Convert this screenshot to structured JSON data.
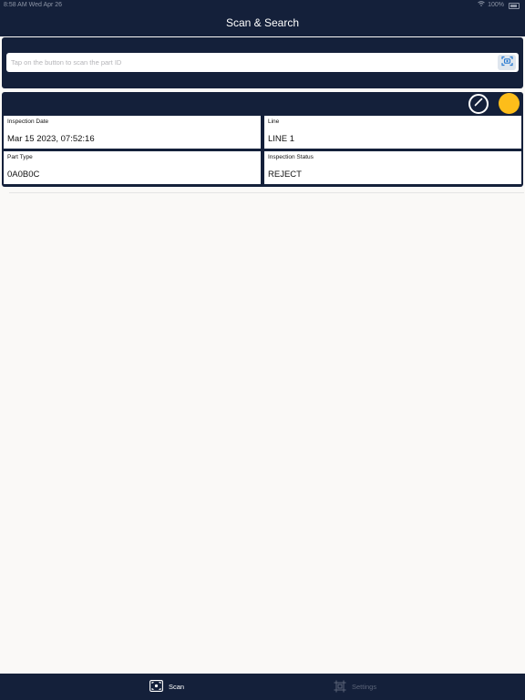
{
  "status_bar": {
    "time_date": "8:58 AM   Wed Apr 26",
    "battery": "100%"
  },
  "nav": {
    "title": "Scan & Search"
  },
  "search": {
    "placeholder": "Tap on the button to scan the part ID",
    "value": ""
  },
  "record": {
    "status_color": "#fdbd1a",
    "fields": [
      {
        "label": "Inspection Date",
        "value": "Mar 15 2023, 07:52:16"
      },
      {
        "label": "Line",
        "value": "LINE 1"
      },
      {
        "label": "Part Type",
        "value": "0A0B0C"
      },
      {
        "label": "Inspection Status",
        "value": "REJECT"
      }
    ]
  },
  "tabs": [
    {
      "label": "Scan",
      "icon": "scan-icon",
      "selected": true
    },
    {
      "label": "Settings",
      "icon": "settings-icon",
      "selected": false
    }
  ],
  "colors": {
    "navy": "#14203a",
    "background": "#faf9f7",
    "tab_inactive": "#5b6478"
  }
}
